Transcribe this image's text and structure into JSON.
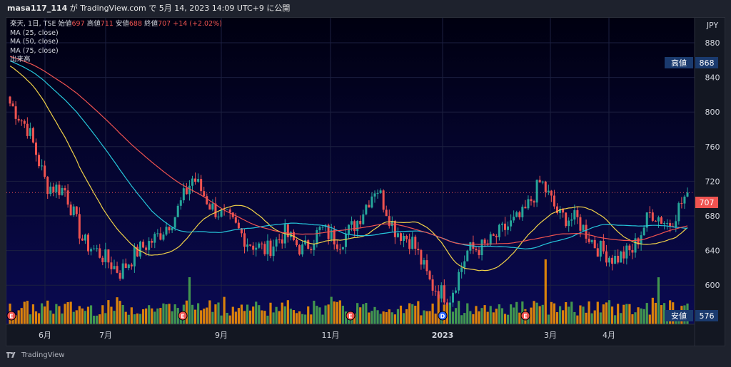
{
  "header": {
    "user": "masa117_114",
    "published_text": "が TradingView.com で 5月 14, 2023 14:09 UTC+9 に公開"
  },
  "legend": {
    "symbol": "楽天, 1日, TSE",
    "open_label": "始値",
    "open_value": "697",
    "high_label": "高値",
    "high_value": "711",
    "low_label": "安値",
    "low_value": "688",
    "close_label": "終値",
    "close_value": "707",
    "change": "+14 (+2.02%)",
    "ma25": "MA (25, close)",
    "ma50": "MA (50, close)",
    "ma75": "MA (75, close)",
    "volume": "出来高"
  },
  "price_axis": {
    "currency": "JPY",
    "ticks": [
      "880",
      "840",
      "800",
      "760",
      "720",
      "680",
      "640",
      "600"
    ],
    "current_price": "707",
    "high_label": "高値",
    "high_value": "868",
    "low_label": "安値",
    "low_value": "576"
  },
  "time_axis": {
    "labels": [
      "6月",
      "7月",
      "9月",
      "11月",
      "2023",
      "3月",
      "4月"
    ]
  },
  "colors": {
    "up": "#26a69a",
    "down": "#ef5350",
    "ma25": "#f0d148",
    "ma50": "#26c6da",
    "ma75": "#ef5350",
    "vol_up": "#4caf50",
    "vol_down": "#ff9800",
    "background": "#000033"
  },
  "events": [
    "E",
    "E",
    "E",
    "D",
    "E"
  ],
  "footer": {
    "brand": "TradingView"
  },
  "chart_data": {
    "type": "candlestick",
    "symbol": "楽天",
    "interval": "1日",
    "ylim": [
      576,
      900
    ],
    "ohlc_keypoints": [
      {
        "x": "5月中旬",
        "close": 810
      },
      {
        "x": "5月下旬",
        "close": 780
      },
      {
        "x": "5月末",
        "close": 715
      },
      {
        "x": "6月上旬",
        "close": 710
      },
      {
        "x": "6月中旬",
        "close": 650
      },
      {
        "x": "6月下旬",
        "close": 635
      },
      {
        "x": "7月上旬",
        "close": 615
      },
      {
        "x": "7月中旬",
        "close": 640
      },
      {
        "x": "7月下旬",
        "close": 655
      },
      {
        "x": "8月上旬",
        "close": 680
      },
      {
        "x": "8月中旬",
        "close": 725
      },
      {
        "x": "8月下旬",
        "close": 690
      },
      {
        "x": "9月上旬",
        "close": 675
      },
      {
        "x": "9月中旬",
        "close": 650
      },
      {
        "x": "9月下旬",
        "close": 640
      },
      {
        "x": "10月上旬",
        "close": 660
      },
      {
        "x": "10月中旬",
        "close": 640
      },
      {
        "x": "10月下旬",
        "close": 665
      },
      {
        "x": "11月上旬",
        "close": 650
      },
      {
        "x": "11月中旬",
        "close": 675
      },
      {
        "x": "11月下旬",
        "close": 715
      },
      {
        "x": "12月上旬",
        "close": 665
      },
      {
        "x": "12月中旬",
        "close": 650
      },
      {
        "x": "12月下旬",
        "close": 600
      },
      {
        "x": "1月上旬",
        "close": 585
      },
      {
        "x": "1月中旬",
        "close": 640
      },
      {
        "x": "1月下旬",
        "close": 645
      },
      {
        "x": "2月上旬",
        "close": 665
      },
      {
        "x": "2月中旬",
        "close": 680
      },
      {
        "x": "2月下旬",
        "close": 720
      },
      {
        "x": "3月上旬",
        "close": 680
      },
      {
        "x": "3月中旬",
        "close": 675
      },
      {
        "x": "3月下旬",
        "close": 645
      },
      {
        "x": "4月上旬",
        "close": 630
      },
      {
        "x": "4月中旬",
        "close": 640
      },
      {
        "x": "4月下旬",
        "close": 685
      },
      {
        "x": "5月上旬",
        "close": 670
      },
      {
        "x": "5月中旬",
        "close": 707
      }
    ]
  }
}
